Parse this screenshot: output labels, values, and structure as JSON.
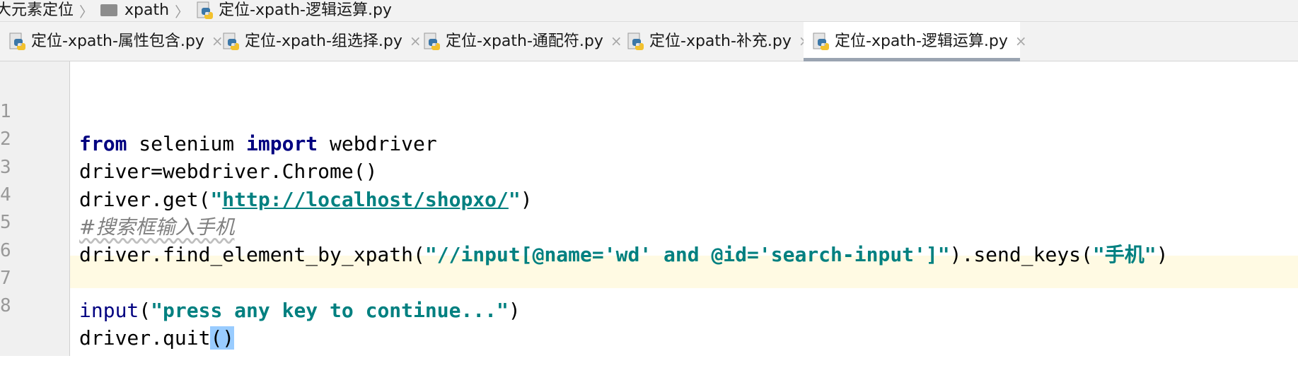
{
  "breadcrumb": {
    "items": [
      "大元素定位",
      "xpath",
      "定位-xpath-逻辑运算.py"
    ],
    "separator": "〉"
  },
  "tabs": [
    {
      "label": "定位-xpath-属性包含.py",
      "close": "×",
      "active": false
    },
    {
      "label": "定位-xpath-组选择.py",
      "close": "×",
      "active": false
    },
    {
      "label": "定位-xpath-通配符.py",
      "close": "×",
      "active": false
    },
    {
      "label": "定位-xpath-补充.py",
      "close": "×",
      "active": false
    },
    {
      "label": "定位-xpath-逻辑运算.py",
      "close": "×",
      "active": true
    }
  ],
  "editor": {
    "line_numbers": [
      "1",
      "2",
      "3",
      "4",
      "5",
      "6",
      "7",
      "8"
    ],
    "current_line": "8",
    "lines": {
      "l1": {
        "kw1": "from",
        "t1": " selenium ",
        "kw2": "import",
        "t2": " webdriver"
      },
      "l2": {
        "t1": "driver=webdriver.Chrome()"
      },
      "l3": {
        "t1": "driver.get(",
        "q1": "\"",
        "url": "http://localhost/shopxo/",
        "q2": "\"",
        "t2": ")"
      },
      "l4": {
        "comment": "#搜索框输入手机"
      },
      "l5": {
        "t1": "driver.find_element_by_xpath(",
        "s1": "\"//input[@name='wd' and @id='search-input']\"",
        "t2": ").send_keys(",
        "s2": "\"手机\"",
        "t3": ")"
      },
      "l6": {
        "t1": ""
      },
      "l7": {
        "fn": "input",
        "t1": "(",
        "s1": "\"press any key to continue...\"",
        "t2": ")"
      },
      "l8": {
        "t1": "driver.quit",
        "br": "()"
      }
    }
  },
  "colors": {
    "keyword": "#000080",
    "string": "#008080",
    "comment": "#808080",
    "current_line": "#fffae3",
    "brace_match": "#99ccff",
    "tab_active_underline": "#9aa4b1"
  },
  "icons": {
    "folder": "folder-icon",
    "python_file": "python-file-icon"
  }
}
